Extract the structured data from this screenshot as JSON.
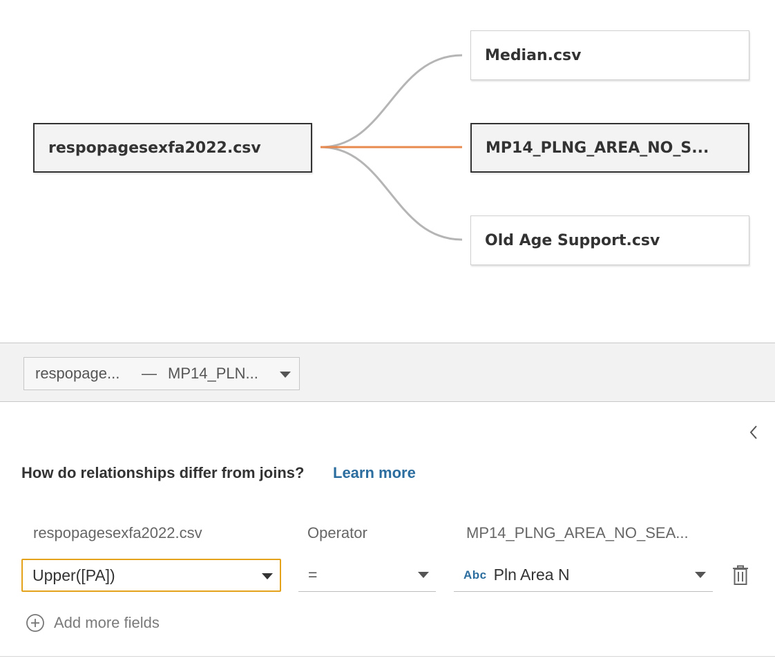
{
  "canvas": {
    "left_table": "respopagesexfa2022.csv",
    "right_tables": [
      "Median.csv",
      "MP14_PLNG_AREA_NO_S...",
      "Old Age Support.csv"
    ],
    "connector_color_active": "#e8894f",
    "connector_color_inactive": "#b5b5b5"
  },
  "relationship_selector": {
    "left": "respopage...",
    "separator": "—",
    "right": "MP14_PLN..."
  },
  "help": {
    "question": "How do relationships differ from joins?",
    "link": "Learn more"
  },
  "columns": {
    "left_header": "respopagesexfa2022.csv",
    "operator_header": "Operator",
    "right_header": "MP14_PLNG_AREA_NO_SEA..."
  },
  "clause": {
    "left_field": "Upper([PA])",
    "operator": "=",
    "right_type_icon": "Abc",
    "right_field": "Pln Area N"
  },
  "add_fields_label": "Add more fields",
  "colors": {
    "accent_link": "#2b6d9e",
    "focus_border": "#e3a21a"
  }
}
